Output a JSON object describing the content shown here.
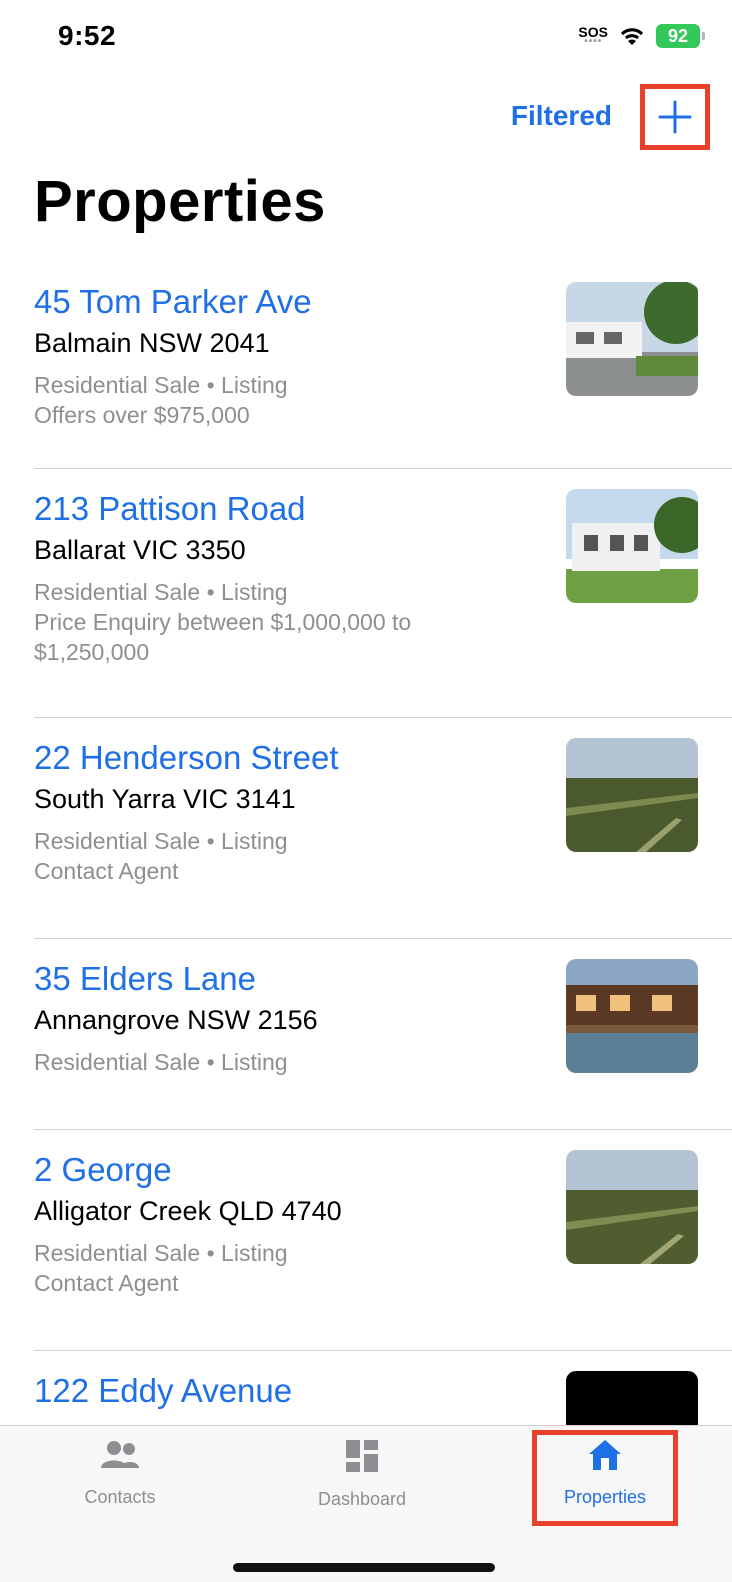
{
  "status": {
    "time": "9:52",
    "sos": "SOS",
    "battery": "92"
  },
  "nav": {
    "filter_label": "Filtered",
    "add_icon": "plus-icon"
  },
  "page": {
    "title": "Properties"
  },
  "properties": [
    {
      "title": "45 Tom Parker Ave",
      "address": "Balmain NSW 2041",
      "meta1": "Residential Sale • Listing",
      "meta2": "Offers over $975,000"
    },
    {
      "title": "213 Pattison Road",
      "address": "Ballarat VIC 3350",
      "meta1": "Residential Sale • Listing",
      "meta2": "Price Enquiry between $1,000,000 to $1,250,000"
    },
    {
      "title": "22 Henderson Street",
      "address": "South Yarra VIC 3141",
      "meta1": "Residential Sale • Listing",
      "meta2": "Contact Agent"
    },
    {
      "title": "35 Elders Lane",
      "address": "Annangrove NSW 2156",
      "meta1": "Residential Sale • Listing"
    },
    {
      "title": "2 George",
      "address": "Alligator Creek QLD 4740",
      "meta1": "Residential Sale • Listing",
      "meta2": "Contact Agent"
    },
    {
      "title": "122 Eddy Avenue"
    }
  ],
  "tabs": {
    "contacts": "Contacts",
    "dashboard": "Dashboard",
    "properties": "Properties"
  },
  "colors": {
    "accent": "#1f6fe6",
    "highlight": "#e8402a",
    "battery": "#34c759"
  }
}
